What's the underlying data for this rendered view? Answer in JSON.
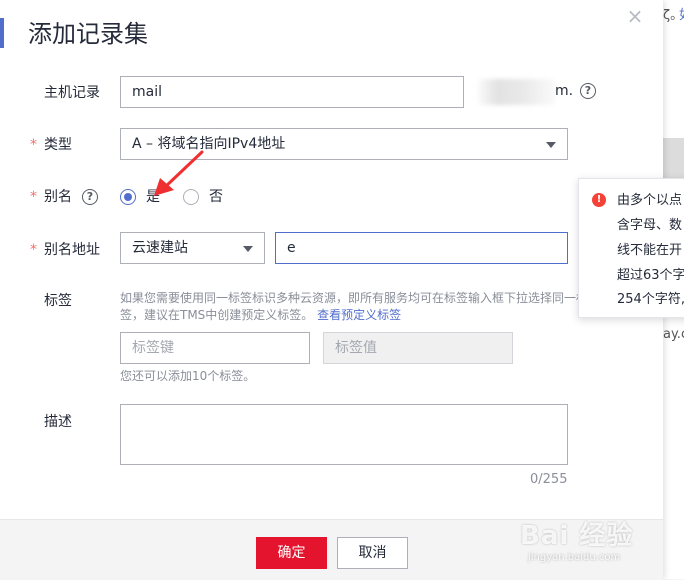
{
  "background": {
    "fragments": [
      "ζ。",
      "如",
      "ay.c"
    ]
  },
  "dialog": {
    "title": "添加记录集",
    "close_glyph": "×"
  },
  "form": {
    "host_record": {
      "label": "主机记录",
      "value": "mail",
      "suffix": "m."
    },
    "type": {
      "label": "类型",
      "value": "A – 将域名指向IPv4地址"
    },
    "alias": {
      "label": "别名",
      "options": [
        {
          "label": "是",
          "checked": true
        },
        {
          "label": "否",
          "checked": false
        }
      ]
    },
    "alias_address": {
      "label": "别名地址",
      "service": "云速建站",
      "value": "e"
    },
    "tags": {
      "label": "标签",
      "hint_line1": "如果您需要使用同一标签标识多种云资源，即所有服务均可在标签输入框下拉选择同一标",
      "hint_line2": "签，建议在TMS中创建预定义标签。",
      "hint_link": "查看预定义标签",
      "key_placeholder": "标签键",
      "value_placeholder": "标签值",
      "remaining": "您还可以添加10个标签。"
    },
    "description": {
      "label": "描述",
      "counter": "0/255"
    }
  },
  "footer": {
    "confirm": "确定",
    "cancel": "取消"
  },
  "tooltip": {
    "icon": "!",
    "lines": [
      "由多个以点",
      "含字母、数",
      "线不能在开",
      "超过63个字",
      "254个字符,"
    ]
  },
  "watermark": {
    "main": "Bai 经验",
    "sub": "jingyan.baidu.com"
  },
  "colors": {
    "accent": "#526ecc",
    "primary_button": "#e4142e",
    "required": "#f66f6a",
    "error": "#f44336",
    "annotation_arrow": "#f03030"
  }
}
